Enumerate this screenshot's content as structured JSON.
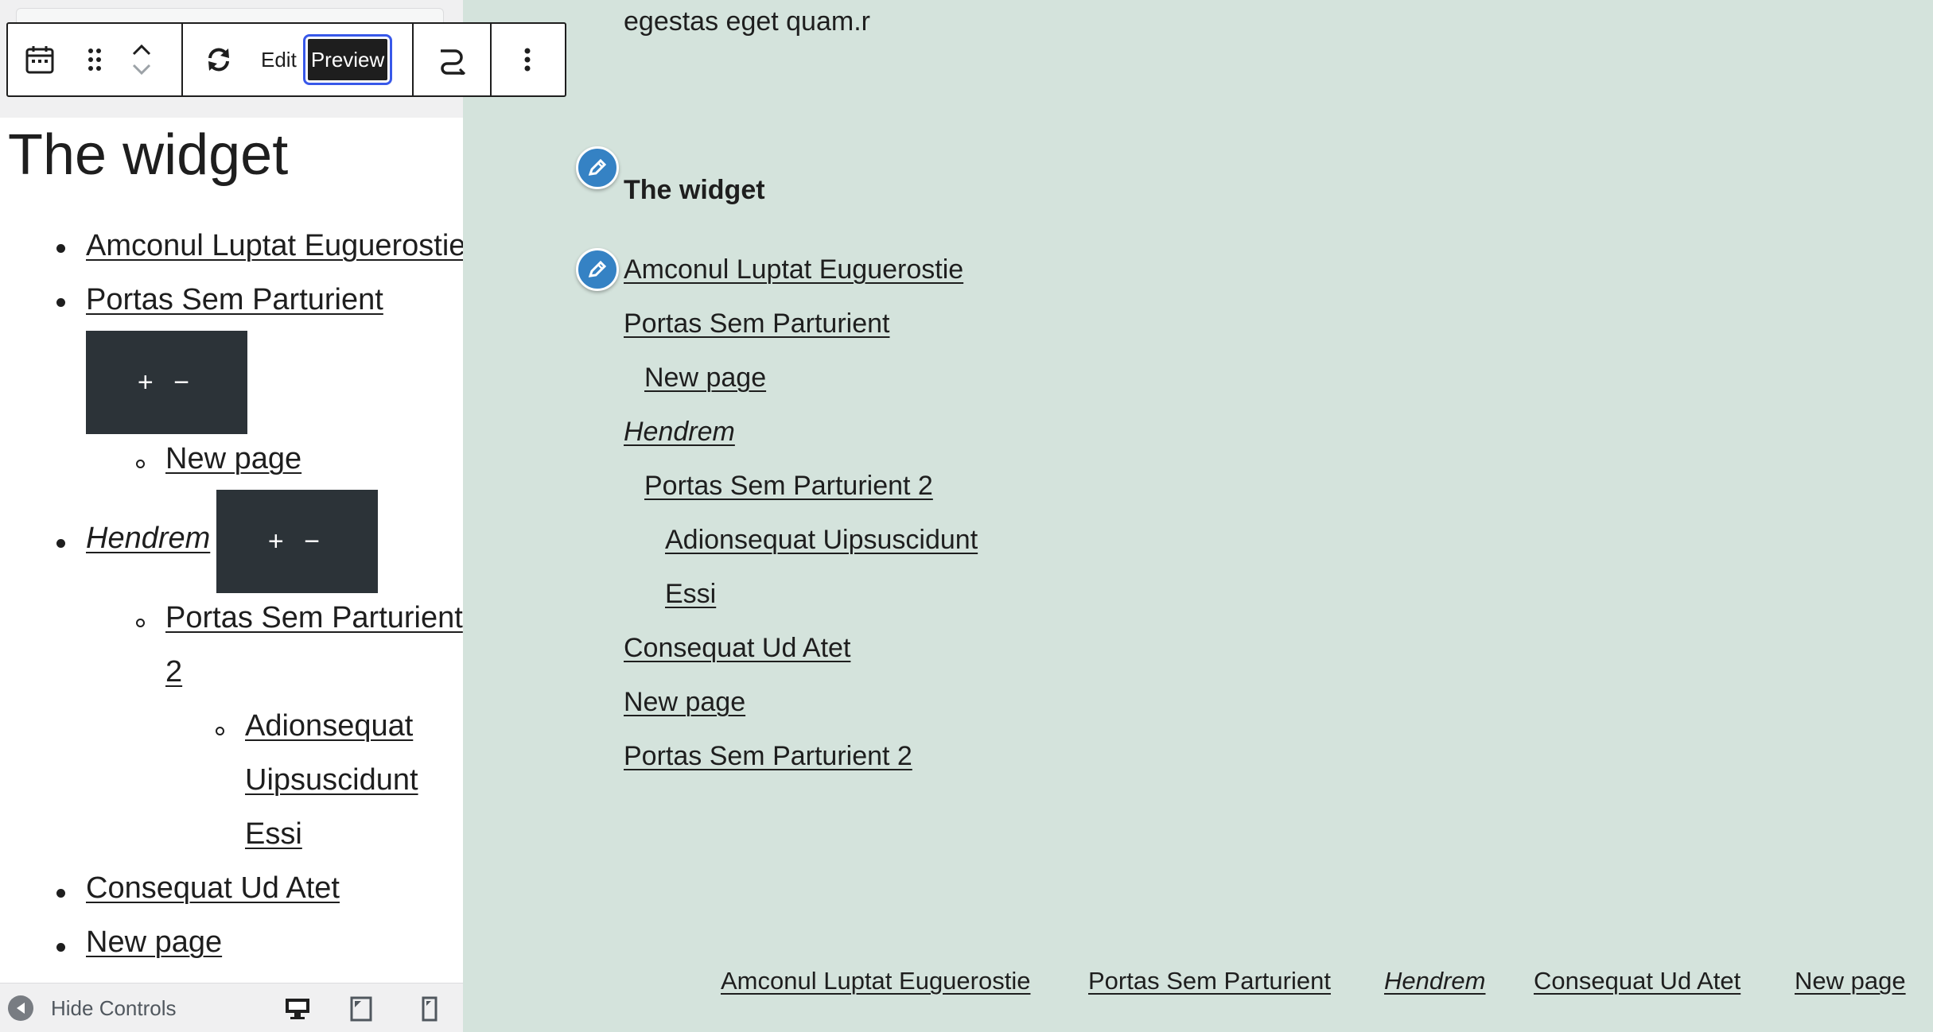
{
  "toolbar": {
    "edit_label": "Edit",
    "preview_label": "Preview",
    "icons": [
      "calendar-icon",
      "drag-handle-icon",
      "chevron-up-icon",
      "chevron-down-icon",
      "refresh-icon",
      "transform-icon",
      "more-options-icon"
    ]
  },
  "editor": {
    "widget_title": "The widget",
    "items": [
      {
        "label": "Amconul Luptat Euguerostie"
      },
      {
        "label": "Portas Sem Parturient"
      },
      {
        "label": "New page"
      },
      {
        "label": "Hendrem"
      },
      {
        "label": "Portas Sem Parturient"
      },
      {
        "label": "2"
      },
      {
        "label": "Adionsequat"
      },
      {
        "label": "Uipsuscidunt"
      },
      {
        "label": "Essi"
      },
      {
        "label": "Consequat Ud Atet"
      },
      {
        "label": "New page"
      }
    ],
    "submenu_controls": "+ −"
  },
  "bottom_bar": {
    "hide_controls_label": "Hide Controls",
    "devices": [
      "desktop-icon",
      "tablet-icon",
      "mobile-icon"
    ]
  },
  "preview": {
    "top_text": "egestas eget quam.r",
    "widget_title": "The widget",
    "menu": [
      {
        "label": "Amconul Luptat Euguerostie"
      },
      {
        "label": "Portas Sem Parturient"
      },
      {
        "label": "New page"
      },
      {
        "label": "Hendrem"
      },
      {
        "label": "Portas Sem Parturient 2"
      },
      {
        "label": "Adionsequat Uipsuscidunt"
      },
      {
        "label": "Essi"
      },
      {
        "label": "Consequat Ud Atet"
      },
      {
        "label": "New page"
      },
      {
        "label": "Portas Sem Parturient 2"
      }
    ],
    "footer_nav": [
      {
        "label": "Amconul Luptat Euguerostie"
      },
      {
        "label": "Portas Sem Parturient"
      },
      {
        "label": "Hendrem"
      },
      {
        "label": "Consequat Ud Atet"
      },
      {
        "label": "New page"
      }
    ]
  },
  "colors": {
    "preview_background": "#d4e3dc",
    "edit_shortcut": "#3582c4",
    "submenu_box": "#2c3338",
    "focus_outline": "#3858e9"
  }
}
